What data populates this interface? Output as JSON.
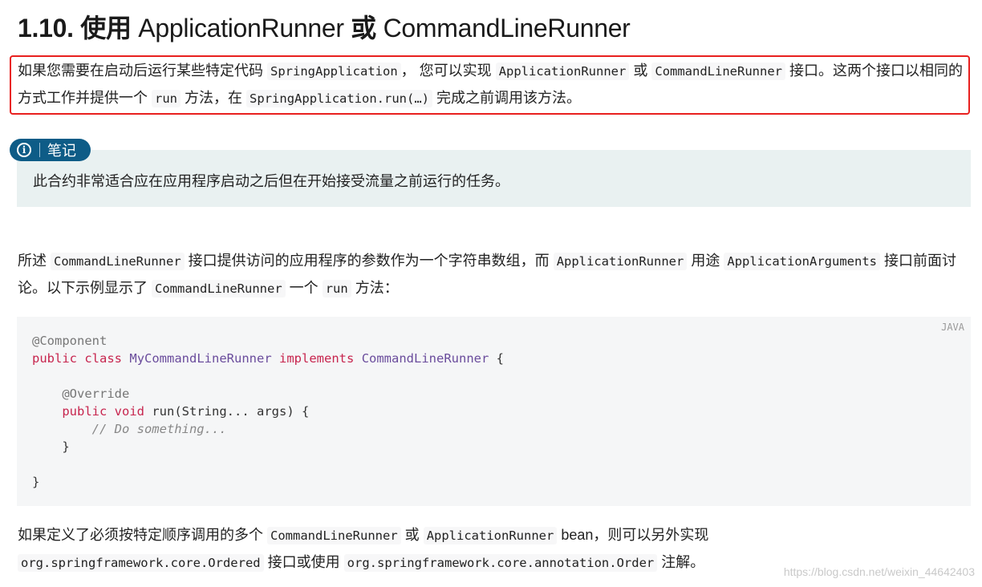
{
  "heading": {
    "number": "1.10.",
    "cn_use": "使用",
    "name1": "ApplicationRunner",
    "cn_or": "或",
    "name2": "CommandLineRunner"
  },
  "intro": {
    "t1": "如果您需要在启动后运行某些特定代码",
    "c1": "SpringApplication",
    "t2": "， 您可以实现",
    "c2": "ApplicationRunner",
    "t3": "或",
    "c3": "CommandLineRunner",
    "t4": "接口。这两个接口以相同的方式工作并提供一个",
    "c4": "run",
    "t5": "方法，在",
    "c5": "SpringApplication.run(…)",
    "t6": "完成之前调用该方法。"
  },
  "note": {
    "label": "笔记",
    "icon": "info-icon",
    "text": "此合约非常适合应在应用程序启动之后但在开始接受流量之前运行的任务。"
  },
  "para2": {
    "t1": "所述",
    "c1": "CommandLineRunner",
    "t2": "接口提供访问的应用程序的参数作为一个字符串数组，而",
    "c2": "ApplicationRunner",
    "t3": "用途",
    "c3": "ApplicationArguments",
    "t4": "接口前面讨论。以下示例显示了",
    "c4": "CommandLineRunner",
    "t5": "一个",
    "c5": "run",
    "t6": "方法："
  },
  "code": {
    "language": "JAVA",
    "ann1": "@Component",
    "kw_public": "public",
    "kw_class": "class",
    "class_name": "MyCommandLineRunner",
    "kw_implements": "implements",
    "iface": "CommandLineRunner",
    "brace_open": "{",
    "ann2": "@Override",
    "kw_void": "void",
    "method_sig": "run(String... args) {",
    "comment": "// Do something...",
    "brace_close": "}"
  },
  "para3": {
    "t1": "如果定义了必须按特定顺序调用的多个",
    "c1": "CommandLineRunner",
    "t2": "或",
    "c2": "ApplicationRunner",
    "t3": "bean，则可以另外实现",
    "c3": "org.springframework.core.Ordered",
    "t4": "接口或使用",
    "c4": "org.springframework.core.annotation.Order",
    "t5": "注解。"
  },
  "watermark": "https://blog.csdn.net/weixin_44642403",
  "colors": {
    "highlight_border": "#e8201f",
    "note_tag_bg": "#0e5c87",
    "note_bg": "#e9f1f1",
    "code_bg": "#f5f6f7"
  }
}
